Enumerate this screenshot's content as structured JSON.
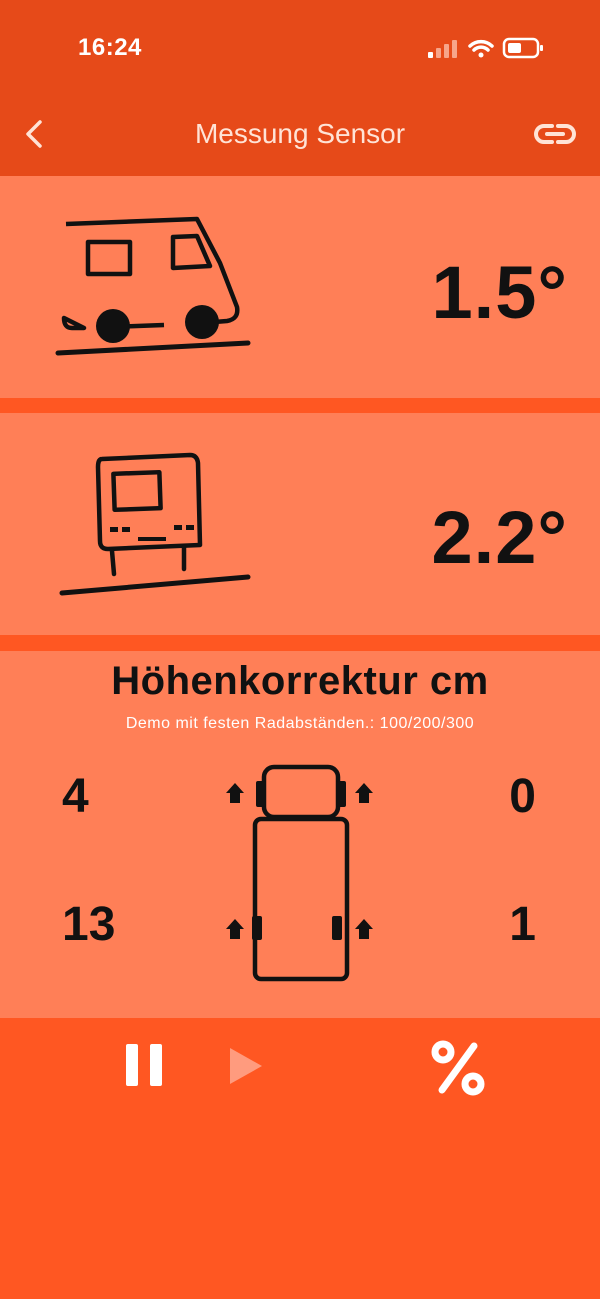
{
  "status_bar": {
    "time": "16:24"
  },
  "nav": {
    "title": "Messung Sensor"
  },
  "pitch": {
    "value": "1.5°"
  },
  "roll": {
    "value": "2.2°"
  },
  "correction": {
    "title": "Höhenkorrektur cm",
    "subtitle": "Demo mit festen Radabständen.: 100/200/300",
    "front_left": "4",
    "front_right": "0",
    "rear_left": "13",
    "rear_right": "1"
  },
  "colors": {
    "header": "#E64A19",
    "background": "#FF5722",
    "card": "#FF7F57",
    "text_dark": "#111111"
  },
  "icons": [
    "back-chevron",
    "link",
    "camper-side",
    "camper-rear",
    "truck-top",
    "pause",
    "play",
    "percent"
  ]
}
